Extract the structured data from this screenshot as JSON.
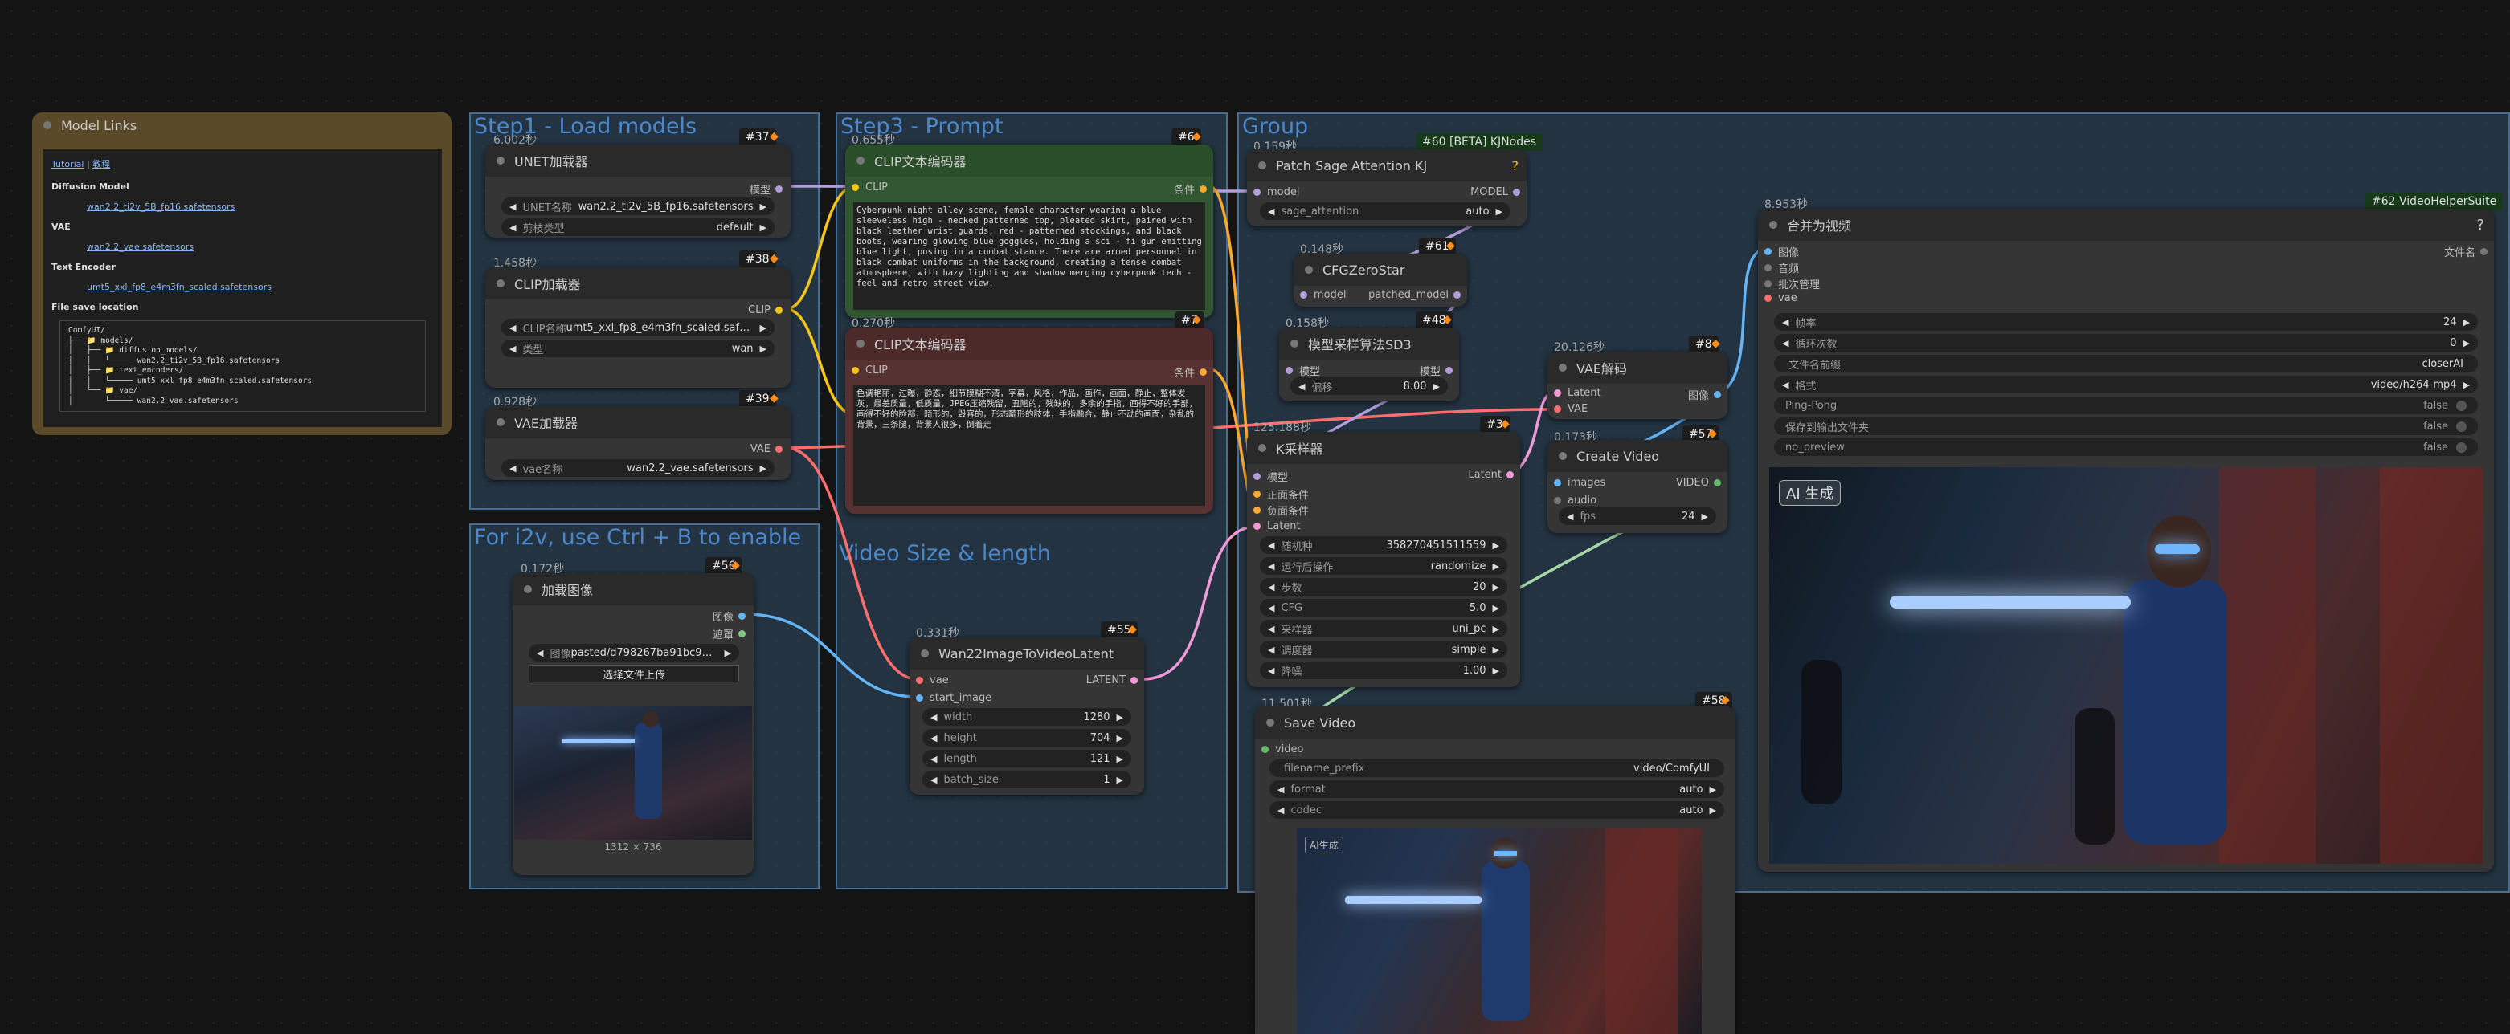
{
  "colors": {
    "clip": "#f5c518",
    "vae": "#ff6e6e",
    "latent": "#f09ad8",
    "model": "#b39ddb",
    "image": "#64b5f6",
    "conditioning": "#ffa931",
    "video": "#66bb6a",
    "mask": "#81c784"
  },
  "model_links": {
    "title": "Model Links",
    "tutorial": "Tutorial",
    "sep": "|",
    "tutorial_cn": "教程",
    "diffusion_heading": "Diffusion Model",
    "diffusion_file": "wan2.2_ti2v_5B_fp16.safetensors",
    "vae_heading": "VAE",
    "vae_file": "wan2.2_vae.safetensors",
    "te_heading": "Text Encoder",
    "te_file": "umt5_xxl_fp8_e4m3fn_scaled.safetensors",
    "save_heading": "File save location",
    "tree": "ComfyUI/\n├── 📁 models/\n│   ├── 📁 diffusion_models/\n│   │   └───── wan2.2_ti2v_5B_fp16.safetensors\n│   ├── 📁 text_encoders/\n│   │   └───── umt5_xxl_fp8_e4m3fn_scaled.safetensors\n│   └── 📁 vae/\n│       └───── wan2.2_vae.safetensors"
  },
  "groups": {
    "step1": "Step1 - Load models",
    "step3": "Step3 - Prompt",
    "group": "Group",
    "i2v": "For i2v, use Ctrl + B to enable",
    "video_size": "Video Size & length"
  },
  "unet": {
    "time": "6.002秒",
    "badge": "#37",
    "title": "UNET加载器",
    "out": "模型",
    "name_label": "UNET名称",
    "name_val": "wan2.2_ti2v_5B_fp16.safetensors",
    "dtype_label": "剪枝类型",
    "dtype_val": "default"
  },
  "clip_loader": {
    "time": "1.458秒",
    "badge": "#38",
    "title": "CLIP加载器",
    "out": "CLIP",
    "name_label": "CLIP名称",
    "name_val": "umt5_xxl_fp8_e4m3fn_scaled.safete…",
    "type_label": "类型",
    "type_val": "wan"
  },
  "vae_loader": {
    "time": "0.928秒",
    "badge": "#39",
    "title": "VAE加载器",
    "out": "VAE",
    "name_label": "vae名称",
    "name_val": "wan2.2_vae.safetensors"
  },
  "load_image": {
    "time": "0.172秒",
    "badge": "#56",
    "title": "加载图像",
    "out_image": "图像",
    "out_mask": "遮罩",
    "image_label": "图像",
    "image_val": "pasted/d798267ba91bc921…",
    "upload": "选择文件上传",
    "dims": "1312 × 736"
  },
  "clip_pos": {
    "time": "0.655秒",
    "badge": "#6",
    "title": "CLIP文本编码器",
    "in": "CLIP",
    "out": "条件",
    "text": "Cyberpunk night alley scene, female character wearing a blue sleeveless high - necked patterned top, pleated skirt, paired with black leather wrist guards, red - patterned stockings, and black boots, wearing glowing blue goggles, holding a sci - fi gun emitting blue light, posing in a combat stance. There are armed personnel in black combat uniforms in the background, creating a tense combat atmosphere, with hazy lighting and shadow merging cyberpunk tech - feel and retro street view."
  },
  "clip_neg": {
    "time": "0.270秒",
    "badge": "#7",
    "title": "CLIP文本编码器",
    "in": "CLIP",
    "out": "条件",
    "text": "色调艳丽，过曝，静态，细节模糊不清，字幕，风格，作品，画作，画面，静止，整体发灰，最差质量，低质量，JPEG压缩残留，丑陋的，残缺的，多余的手指，画得不好的手部，画得不好的脸部，畸形的，毁容的，形态畸形的肢体，手指融合，静止不动的画面，杂乱的背景，三条腿，背景人很多，倒着走"
  },
  "wan22": {
    "time": "0.331秒",
    "badge": "#55",
    "title": "Wan22ImageToVideoLatent",
    "in_vae": "vae",
    "in_start": "start_image",
    "out": "LATENT",
    "width_label": "width",
    "width_val": "1280",
    "height_label": "height",
    "height_val": "704",
    "length_label": "length",
    "length_val": "121",
    "batch_label": "batch_size",
    "batch_val": "1"
  },
  "sage": {
    "time": "0.159秒",
    "badge": "#60 [BETA] KJNodes",
    "title": "Patch Sage Attention KJ",
    "help": "?",
    "in": "model",
    "out": "MODEL",
    "attn_label": "sage_attention",
    "attn_val": "auto"
  },
  "cfgzero": {
    "time": "0.148秒",
    "badge": "#61",
    "title": "CFGZeroStar",
    "in": "model",
    "out": "patched_model"
  },
  "sd3": {
    "time": "0.158秒",
    "badge": "#48",
    "title": "模型采样算法SD3",
    "in": "模型",
    "out": "模型",
    "shift_label": "偏移",
    "shift_val": "8.00"
  },
  "ksampler": {
    "time": "125.188秒",
    "badge": "#3",
    "title": "K采样器",
    "in_model": "模型",
    "in_pos": "正面条件",
    "in_neg": "负面条件",
    "in_latent": "Latent",
    "out": "Latent",
    "seed_label": "随机种",
    "seed_val": "358270451511559",
    "ctrl_label": "运行后操作",
    "ctrl_val": "randomize",
    "steps_label": "步数",
    "steps_val": "20",
    "cfg_label": "CFG",
    "cfg_val": "5.0",
    "sampler_label": "采样器",
    "sampler_val": "uni_pc",
    "sched_label": "调度器",
    "sched_val": "simple",
    "denoise_label": "降噪",
    "denoise_val": "1.00"
  },
  "vae_decode": {
    "time": "20.126秒",
    "badge": "#8",
    "title": "VAE解码",
    "in_latent": "Latent",
    "in_vae": "VAE",
    "out": "图像"
  },
  "create_video": {
    "time": "0.173秒",
    "badge": "#57",
    "title": "Create Video",
    "in_images": "images",
    "in_audio": "audio",
    "out": "VIDEO",
    "fps_label": "fps",
    "fps_val": "24"
  },
  "save_video": {
    "time": "11.501秒",
    "badge": "#58",
    "title": "Save Video",
    "in": "video",
    "prefix_label": "filename_prefix",
    "prefix_val": "video/ComfyUI",
    "format_label": "format",
    "format_val": "auto",
    "codec_label": "codec",
    "codec_val": "auto",
    "watermark": "AI生成"
  },
  "combine": {
    "time": "8.953秒",
    "badge": "#62 VideoHelperSuite",
    "title": "合并为视频",
    "help": "?",
    "in_images": "图像",
    "in_audio": "音频",
    "in_batch": "批次管理",
    "in_vae": "vae",
    "out": "文件名",
    "fps_label": "帧率",
    "fps_val": "24",
    "loop_label": "循环次数",
    "loop_val": "0",
    "prefix_label": "文件名前缀",
    "prefix_val": "closerAI",
    "format_label": "格式",
    "format_val": "video/h264-mp4",
    "pp_label": "Ping-Pong",
    "pp_val": "false",
    "save_label": "保存到输出文件夹",
    "save_val": "false",
    "np_label": "no_preview",
    "np_val": "false",
    "watermark": "AI 生成"
  }
}
